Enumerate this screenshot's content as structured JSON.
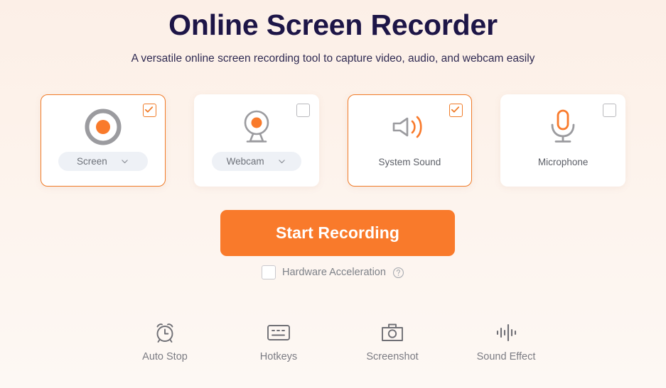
{
  "header": {
    "title": "Online Screen Recorder",
    "subtitle": "A versatile online screen recording tool to capture video, audio, and webcam easily"
  },
  "colors": {
    "accent_orange": "#f97a2b",
    "title_navy": "#1d1547",
    "icon_gray": "#9a9a9e",
    "card_white": "#ffffff",
    "pill_gray": "#eef1f6",
    "background_top": "#fcefe7",
    "background_bottom": "#fdf8f4"
  },
  "sources": [
    {
      "id": "screen",
      "label": "Screen",
      "icon": "record-circle-icon",
      "checked": true,
      "selected": true,
      "has_dropdown": true
    },
    {
      "id": "webcam",
      "label": "Webcam",
      "icon": "webcam-icon",
      "checked": false,
      "selected": false,
      "has_dropdown": true
    },
    {
      "id": "system-sound",
      "label": "System Sound",
      "icon": "speaker-icon",
      "checked": true,
      "selected": true,
      "has_dropdown": false
    },
    {
      "id": "microphone",
      "label": "Microphone",
      "icon": "microphone-icon",
      "checked": false,
      "selected": false,
      "has_dropdown": false
    }
  ],
  "actions": {
    "start_recording_label": "Start Recording",
    "hardware_acceleration_label": "Hardware Acceleration",
    "hardware_acceleration_checked": false,
    "help_icon": "question-mark-circle-icon"
  },
  "tools": [
    {
      "id": "auto-stop",
      "label": "Auto Stop",
      "icon": "alarm-clock-icon"
    },
    {
      "id": "hotkeys",
      "label": "Hotkeys",
      "icon": "keyboard-icon"
    },
    {
      "id": "screenshot",
      "label": "Screenshot",
      "icon": "camera-icon"
    },
    {
      "id": "sound-effect",
      "label": "Sound Effect",
      "icon": "waveform-icon"
    }
  ]
}
